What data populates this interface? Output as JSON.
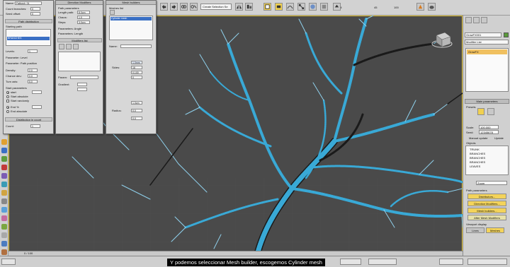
{
  "toolbar": {
    "selection_set": "Create Selection Se",
    "view_mode": "All",
    "percent": "100",
    "snap_label": "45"
  },
  "left_dialog": {
    "title": "Name:",
    "name_value": "Fatbush_01",
    "count_label": "Count branches:",
    "seed_label": "Seed offset:",
    "count_val": "0",
    "seed_val": "0",
    "section": "Path distribution",
    "start_label": "Starting path",
    "list_item": "BRANCHES",
    "levels_label": "Levels:",
    "levels_val": "1",
    "param_level": "Parameter: Level",
    "param_path": "Parameter: Path position",
    "density_label": "Density:",
    "density_val": "2.0",
    "chance_label": "Chance dev.:",
    "chance_val": "0.0",
    "turn_label": "Turn axis:",
    "turn_val": "5.0",
    "start_section": "Start parameters",
    "start_radio": "start",
    "start_abs": "Start absolute",
    "start_rand": "Start randomly",
    "end_section": "End %",
    "end_abs": "End absolute",
    "dist_section": "Distribution in count",
    "count2_label": "Count:",
    "count2_val": "1"
  },
  "mid_dialog": {
    "title": "Direction Modifiers",
    "path_section": "Path parameters",
    "length_label": "Length path:",
    "length_val": "8.0cm",
    "chaos_label": "Chaos:",
    "chaos_val": "1.0",
    "steps_label": "Steps:",
    "steps_val": "3.0cm",
    "param_angle": "Parameters: Angle",
    "param_length": "Parameters: Length",
    "modifiers_label": "Modifiers list",
    "extra_label": "Param:",
    "gradient_label": "Gradient:"
  },
  "right_dialog": {
    "title": "Mesh builders",
    "list_label": "Meshes list",
    "list_item": "Cylinder mesh",
    "name_label": "Name:",
    "field1": "1.0mm",
    "field2": "16",
    "field3": "0.100",
    "field4": "0",
    "lbl_a": "Sides:",
    "lbl_b": "Radius:",
    "field5": "1.0cm",
    "field6": "0.0",
    "field7": "0.0"
  },
  "command_panel": {
    "object_name": "GrowFX001",
    "modifier_list": "Modifier List",
    "stack_item": "GrowFX",
    "main_params": "Main parameters",
    "presets": "Presets",
    "scale_label": "Scale:",
    "scale_val": "100.000",
    "seed_label": "Seed:",
    "seed_val": "12345678",
    "manual_update": "Manual update",
    "update": "Update",
    "obj_label": "Objects",
    "tree_items": [
      "TRUNK",
      "BRANCHES",
      "BRANCHES",
      "BRANCHES",
      "LEAVES"
    ],
    "name_field": "Zoom",
    "path_params": "Path parameters",
    "distributors": "Distributors...",
    "direction_mods": "Direction Modifiers...",
    "mesh_builders": "Mesh builders...",
    "after_mesh": "After Mesh Modifiers",
    "viewport_display": "Viewport display",
    "lines": "Lines",
    "meshes": "Meshes"
  },
  "timeline": {
    "frame": "0 / 100"
  },
  "subtitle": "Y podemos seleccionar Mesh builder, escogemos Cylinder mesh",
  "colors": {
    "viewport_bg": "#4a4a4a",
    "branch_cyan": "#39a9d6",
    "highlight_yellow": "#f3d35a",
    "selected_orange": "#f0c060"
  }
}
